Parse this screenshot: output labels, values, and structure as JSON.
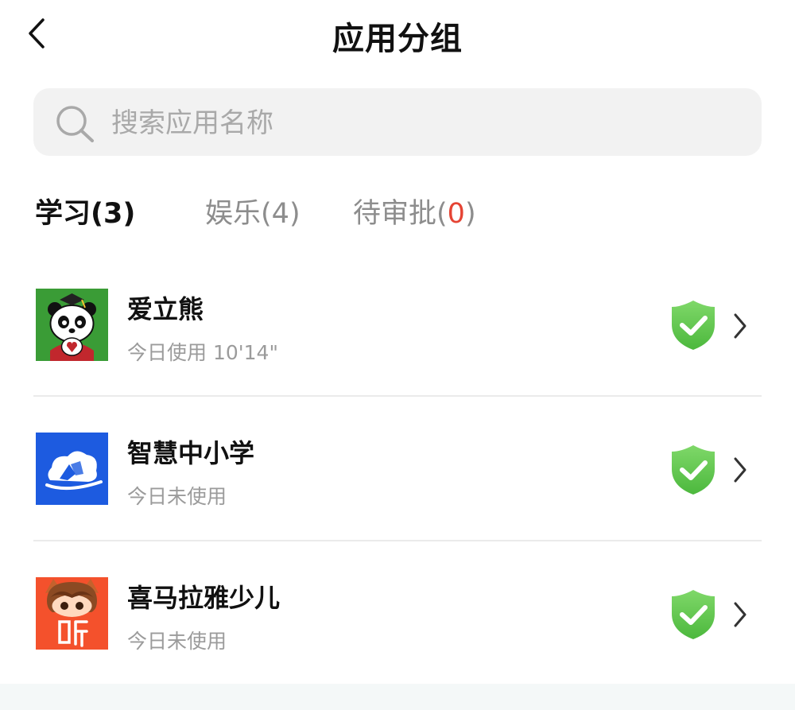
{
  "header": {
    "title": "应用分组"
  },
  "search": {
    "placeholder": "搜索应用名称"
  },
  "tabs": [
    {
      "name": "学习",
      "count": "3",
      "active": true
    },
    {
      "name": "娱乐",
      "count": "4",
      "active": false
    },
    {
      "name": "待审批",
      "count": "0",
      "active": false
    }
  ],
  "apps": [
    {
      "name": "爱立熊",
      "usage": "今日使用 10'14\"",
      "icon": "panda-icon",
      "icon_bg": "#3a9c36",
      "status": "shield-check-icon"
    },
    {
      "name": "智慧中小学",
      "usage": "今日未使用",
      "icon": "cloud-book-icon",
      "icon_bg": "#1d5be0",
      "status": "shield-check-icon"
    },
    {
      "name": "喜马拉雅少儿",
      "usage": "今日未使用",
      "icon": "listen-icon",
      "icon_bg": "#f4512c",
      "status": "shield-check-icon"
    }
  ],
  "colors": {
    "shield_green": "#5fc94f",
    "badge_red": "#e54434",
    "search_bg": "#f2f2f2"
  }
}
